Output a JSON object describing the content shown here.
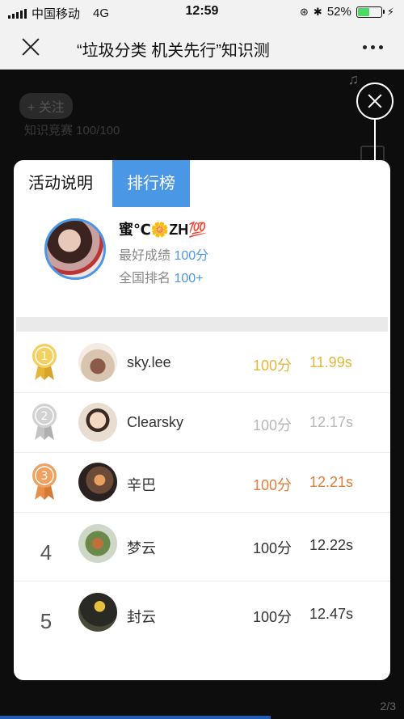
{
  "status_bar": {
    "carrier": "中国移动",
    "network": "4G",
    "time": "12:59",
    "battery": "52%",
    "battery_level": 0.52
  },
  "title_bar": {
    "title": "“垃圾分类 机关先行”知识测"
  },
  "background": {
    "follow_label": "+ 关注",
    "subtitle": "知识竞赛 100/100",
    "page_indicator": "2/3"
  },
  "tabs": [
    {
      "label": "活动说明",
      "active": false
    },
    {
      "label": "排行榜",
      "active": true
    }
  ],
  "me": {
    "name": "蜜℃🌼ZH💯",
    "best_label": "最好成绩",
    "best_value": "100分",
    "rank_label": "全国排名",
    "rank_value": "100+"
  },
  "leaderboard": [
    {
      "rank": "1",
      "medal": "gold",
      "name": "sky.lee",
      "score": "100分",
      "time": "11.99s"
    },
    {
      "rank": "2",
      "medal": "silver",
      "name": "Clearsky",
      "score": "100分",
      "time": "12.17s"
    },
    {
      "rank": "3",
      "medal": "bronze",
      "name": "辛巴",
      "score": "100分",
      "time": "12.21s"
    },
    {
      "rank": "4",
      "medal": "",
      "name": "梦云",
      "score": "100分",
      "time": "12.22s"
    },
    {
      "rank": "5",
      "medal": "",
      "name": "封云",
      "score": "100分",
      "time": "12.47s"
    }
  ],
  "colors": {
    "accent": "#4a98e5",
    "gold": "#e6b63a",
    "silver": "#b7b7b7",
    "bronze": "#e07e3a"
  }
}
